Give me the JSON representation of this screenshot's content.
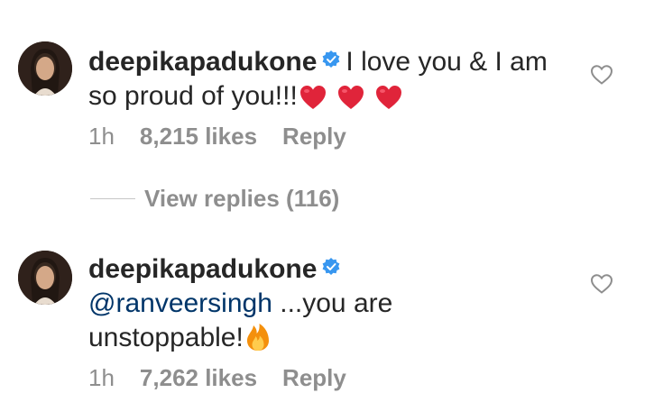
{
  "comments": [
    {
      "username": "deepikapadukone",
      "verified": true,
      "text": "I love you & I am so proud of you!!!",
      "emojis": [
        "heart",
        "heart",
        "heart"
      ],
      "time": "1h",
      "likes": "8,215 likes",
      "reply": "Reply"
    },
    {
      "username": "deepikapadukone",
      "verified": true,
      "mention": "@ranveersingh",
      "text": " ...you are unstoppable!",
      "emojis": [
        "fire"
      ],
      "time": "1h",
      "likes": "7,262 likes",
      "reply": "Reply"
    }
  ],
  "view_replies": "View replies (116)",
  "colors": {
    "text": "#262626",
    "secondary": "#8e8e8e",
    "mention": "#003569",
    "verified": "#3897f0",
    "heart_emoji": "#e0243a",
    "fire_emoji": "#f4900c"
  },
  "icons": {
    "verified": "verified-badge-icon",
    "like": "heart-outline-icon",
    "emoji_heart": "red-heart-emoji",
    "emoji_fire": "fire-emoji"
  }
}
